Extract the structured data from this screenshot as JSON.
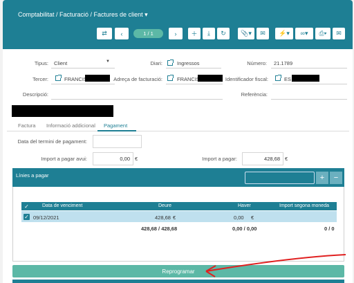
{
  "header": {
    "breadcrumb": "Comptabilitat / Facturació / Factures de client",
    "pager": "1 / 1"
  },
  "form": {
    "tipus_label": "Tipus:",
    "tipus_value": "Client",
    "diari_label": "Diari:",
    "diari_value": "Ingressos",
    "numero_label": "Número:",
    "numero_value": "21.1789",
    "tercer_label": "Tercer:",
    "tercer_value": "FRANCIS",
    "adreca_label": "Adreça de facturació:",
    "adreca_value": "FRANCIS",
    "identificador_label": "Identificador fiscal:",
    "identificador_value": "ES",
    "descripcio_label": "Descripció:",
    "referencia_label": "Referència:"
  },
  "tabs": [
    {
      "label": "Factura"
    },
    {
      "label": "Informació addicional"
    },
    {
      "label": "Pagament"
    }
  ],
  "payment": {
    "termini_label": "Data del termini de pagament:",
    "avui_label": "Import a pagar avui:",
    "avui_value": "0,00",
    "avui_currency": "€",
    "pagar_label": "Import a pagar:",
    "pagar_value": "428,68",
    "pagar_currency": "€"
  },
  "lines": {
    "title": "Línies a pagar",
    "plus": "+",
    "minus": "−",
    "columns": [
      "Data de venciment",
      "Deure",
      "Haver",
      "Import segona moneda"
    ],
    "rows": [
      {
        "date": "09/12/2021",
        "deure": "428,68",
        "deure_cur": "€",
        "haver": "0,00",
        "haver_cur": "€",
        "segona": ""
      }
    ],
    "totals": {
      "deure": "428,68 / 428,68",
      "haver": "0,00 / 0,00",
      "segona": "0 / 0"
    }
  },
  "actions": {
    "reprogramar": "Reprogramar"
  },
  "colors": {
    "primary": "#1e7f94",
    "accent": "#5cb8a6",
    "row_selected": "#bfe0ee",
    "annotation_arrow": "#e02020"
  }
}
